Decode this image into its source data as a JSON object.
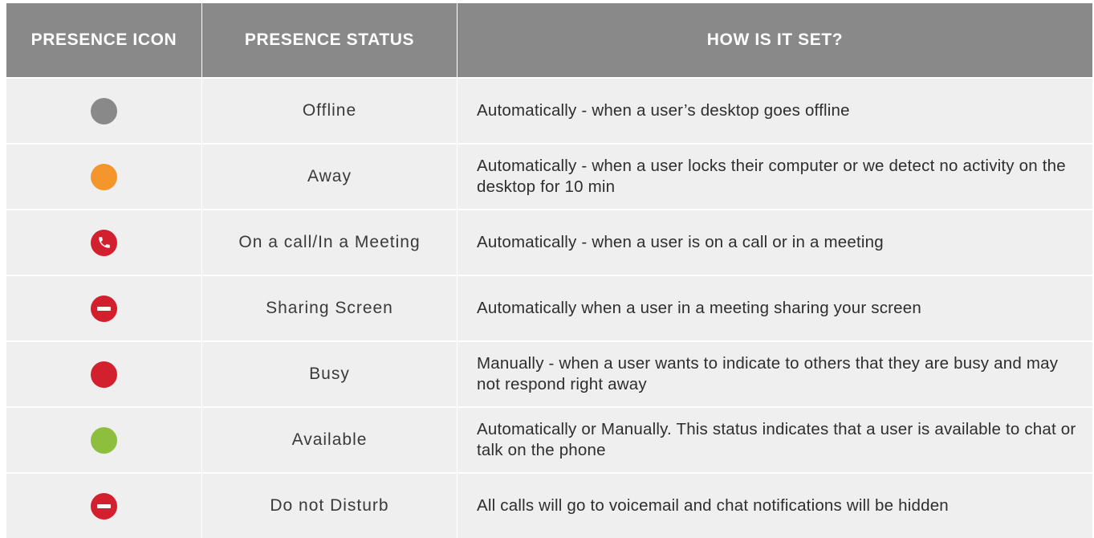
{
  "colors": {
    "header_bg": "#8a8989",
    "row_bg": "#efefef",
    "offline": "#8a8989",
    "away": "#f4962b",
    "red": "#d2202f",
    "available": "#8dbe3e"
  },
  "header": {
    "col1": "PRESENCE ICON",
    "col2": "PRESENCE STATUS",
    "col3": "HOW IS IT SET?"
  },
  "rows": [
    {
      "icon": "gray-dot-icon",
      "status": "Offline",
      "how": "Automatically - when a user’s desktop goes offline"
    },
    {
      "icon": "orange-dot-icon",
      "status": "Away",
      "how": "Automatically - when a user locks their computer or we detect no activity on the desktop for 10 min"
    },
    {
      "icon": "red-phone-icon",
      "status": "On a call/In a Meeting",
      "how": "Automatically - when a user is on a call or in a meeting"
    },
    {
      "icon": "red-minus-icon",
      "status": "Sharing Screen",
      "how": "Automatically when  a user in a meeting sharing your screen"
    },
    {
      "icon": "red-dot-icon",
      "status": "Busy",
      "how": "Manually - when a user wants to indicate to others that they are busy and may not respond right away"
    },
    {
      "icon": "green-dot-icon",
      "status": "Available",
      "how": "Automatically or Manually.  This status indicates that a user is available to chat or talk on the phone"
    },
    {
      "icon": "red-minus-icon",
      "status": "Do not Disturb",
      "how": "All calls will go to voicemail and chat notifications will be hidden"
    }
  ]
}
